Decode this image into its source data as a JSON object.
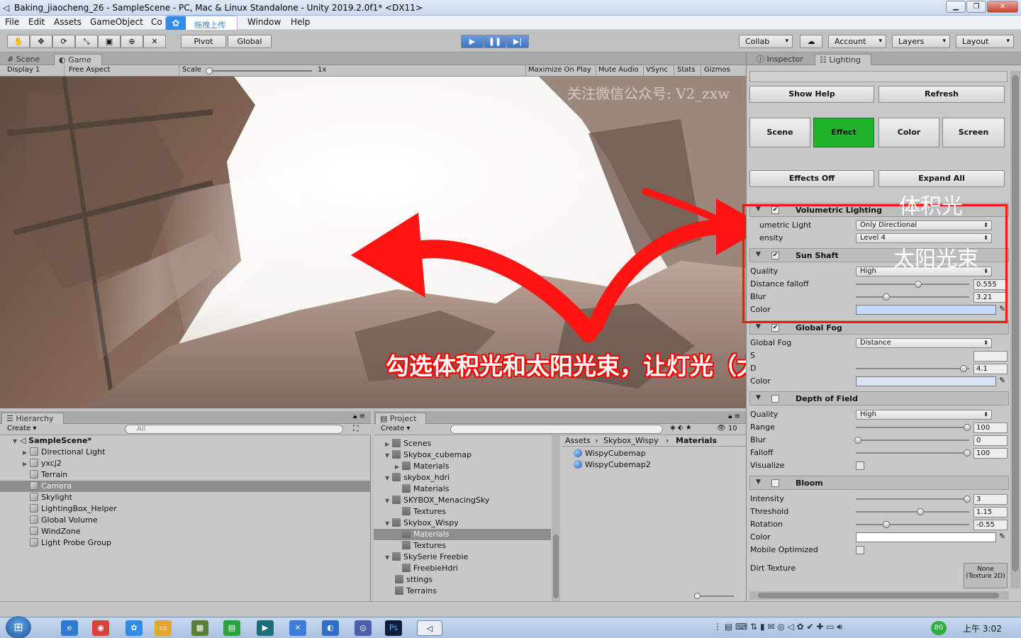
{
  "window": {
    "title": "Baking_jiaocheng_26 - SampleScene - PC, Mac & Linux Standalone - Unity 2019.2.0f1* <DX11>",
    "upload_badge": "拖拽上传"
  },
  "menu": [
    "File",
    "Edit",
    "Assets",
    "GameObject",
    "Co",
    "Window",
    "Help"
  ],
  "toolbar": {
    "pivot": "Pivot",
    "global": "Global",
    "collab": "Collab",
    "account": "Account",
    "layers": "Layers",
    "layout": "Layout"
  },
  "scene_tabs": [
    "Scene",
    "Game"
  ],
  "game_bar": {
    "display": "Display 1",
    "aspect": "Free Aspect",
    "scale_label": "Scale",
    "scale_value": "1x",
    "maximize": "Maximize On Play",
    "mute": "Mute Audio",
    "vsync": "VSync",
    "stats": "Stats",
    "gizmos": "Gizmos"
  },
  "watermark": "关注微信公众号: V2_zxw",
  "inspector": {
    "tabs": [
      "Inspector",
      "Lighting"
    ],
    "show_help": "Show Help",
    "refresh": "Refresh",
    "modes": [
      "Scene",
      "Effect",
      "Color",
      "Screen"
    ],
    "effects_off": "Effects Off",
    "expand_all": "Expand All",
    "volumetric": {
      "title": "Volumetric Lighting",
      "light_label": "umetric Light",
      "light_value": "Only Directional",
      "intensity_label": "ensity",
      "intensity_value": "Level 4"
    },
    "sunshaft": {
      "title": "Sun Shaft",
      "quality_label": "Quality",
      "quality_value": "High",
      "falloff_label": "Distance falloff",
      "falloff_value": "0.555",
      "blur_label": "Blur",
      "blur_value": "3.21",
      "color_label": "Color"
    },
    "fog": {
      "title": "Global Fog",
      "fog_label": "Global Fog",
      "fog_value": "Distance",
      "s_label": "S",
      "d_label": "D",
      "d_value": "4.1",
      "color_label": "Color"
    },
    "dof": {
      "title": "Depth of Field",
      "quality_label": "Quality",
      "quality_value": "High",
      "range_label": "Range",
      "range_value": "100",
      "blur_label": "Blur",
      "blur_value": "0",
      "falloff_label": "Falloff",
      "falloff_value": "100",
      "visualize_label": "Visualize"
    },
    "bloom": {
      "title": "Bloom",
      "intensity_label": "Intensity",
      "intensity_value": "3",
      "threshold_label": "Threshold",
      "threshold_value": "1.15",
      "rotation_label": "Rotation",
      "rotation_value": "-0.55",
      "color_label": "Color",
      "mobile_label": "Mobile Optimized",
      "dirt_label": "Dirt Texture",
      "dirt_value": "None (Texture 2D)"
    }
  },
  "annotations": {
    "volumetric_cn": "体积光",
    "sunshaft_cn": "太阳光束",
    "main_cn": "勾选体积光和太阳光束，让灯光（太阳）光束可见"
  },
  "hierarchy": {
    "title": "Hierarchy",
    "create": "Create",
    "search": "All",
    "scene": "SampleScene*",
    "items": [
      "Directional Light",
      "yxcj2",
      "Terrain",
      "Camera",
      "Skylight",
      "LightingBox_Helper",
      "Global Volume",
      "WindZone",
      "Light Probe Group"
    ]
  },
  "project": {
    "title": "Project",
    "create": "Create",
    "count": "10",
    "tree": [
      "Scenes",
      "Skybox_cubemap",
      "Materials",
      "skybox_hdri",
      "Materials",
      "SKYBOX_MenacingSky",
      "Textures",
      "Skybox_Wispy",
      "Materials",
      "Textures",
      "SkySerie Freebie",
      "FreebieHdri",
      "sttings",
      "Terrains"
    ],
    "breadcrumb": [
      "Assets",
      "Skybox_Wispy",
      "Materials"
    ],
    "files": [
      "WispyCubemap",
      "WispyCubemap2"
    ]
  },
  "taskbar": {
    "clock": "上午 3:02",
    "badge": "80"
  },
  "colors": {
    "effect_active": "#21b32a",
    "annotation_red": "#ff1313",
    "sunshaft_color": "#c5d9fb",
    "fog_color": "#d6e4f6"
  }
}
